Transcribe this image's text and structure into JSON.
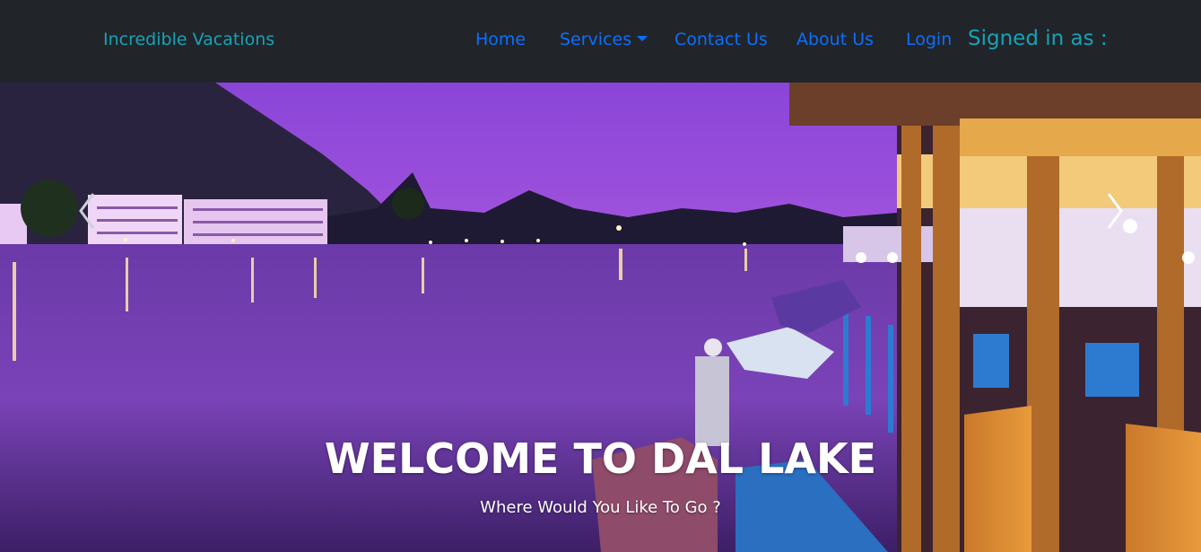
{
  "navbar": {
    "brand": "Incredible Vacations",
    "links": {
      "home": "Home",
      "services": "Services",
      "contact": "Contact Us",
      "about": "About Us",
      "login": "Login"
    },
    "signed_in_text": "Signed in as :"
  },
  "carousel": {
    "title": "WELCOME TO DAL LAKE",
    "subtitle": "Where Would You Like To Go ?",
    "prev_icon": "chevron-left-icon",
    "next_icon": "chevron-right-icon"
  },
  "colors": {
    "navbar_bg": "#212529",
    "brand": "#17a2b8",
    "link": "#0d6efd",
    "sky": "#9b4fd6",
    "lake": "#5a2a8e"
  }
}
